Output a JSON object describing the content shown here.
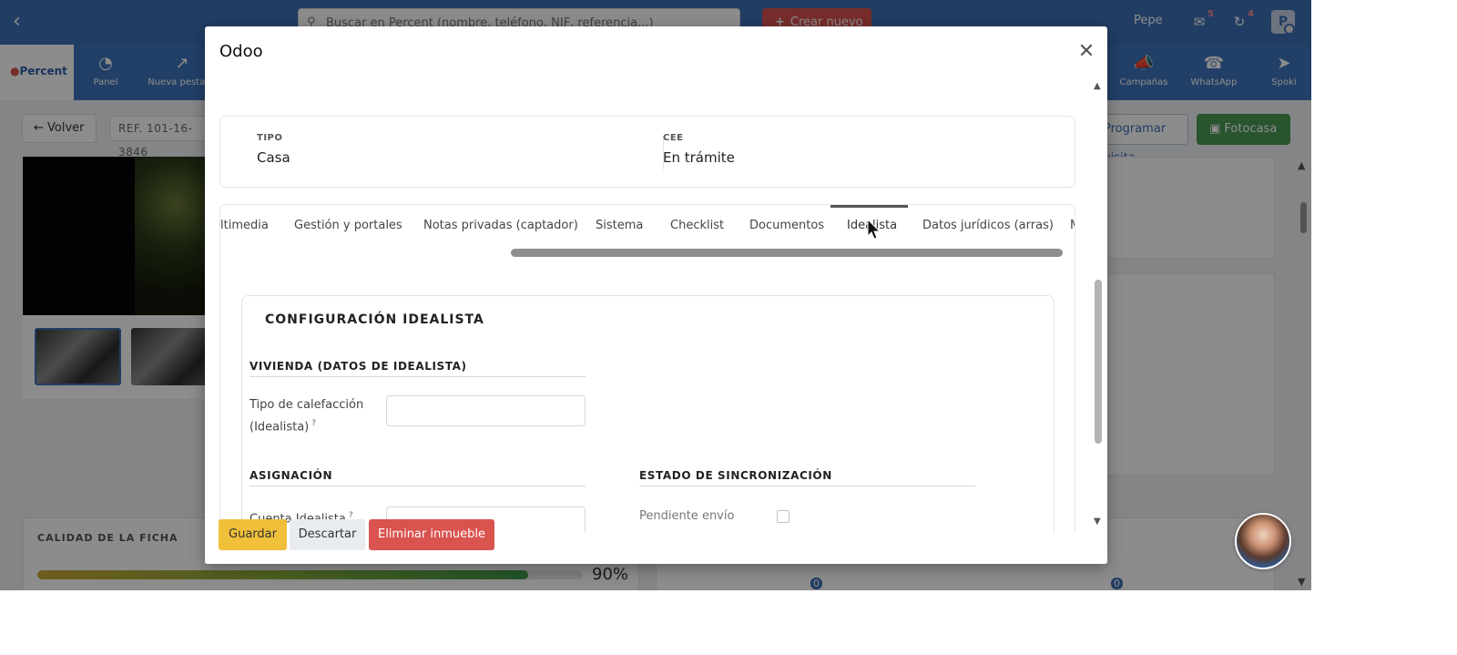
{
  "topbar": {
    "search_placeholder": "Buscar en Percent (nombre, teléfono, NIF, referencia...)",
    "create_label": "Crear nuevo",
    "user_name": "Pepe",
    "messages_badge": "5",
    "history_badge": "4",
    "avatar_initial": "P"
  },
  "nav": {
    "logo_brand": "Percent",
    "items": [
      {
        "label": "Panel",
        "icon": "dashboard-icon"
      },
      {
        "label": "Nueva pestaña",
        "icon": "external-link-icon"
      },
      {
        "label": "Campañas",
        "icon": "megaphone-icon"
      },
      {
        "label": "WhatsApp",
        "icon": "whatsapp-icon"
      },
      {
        "label": "Spoki",
        "icon": "paper-plane-icon"
      }
    ]
  },
  "page": {
    "back_label": "Volver",
    "reference": "REF. 101-16-3846",
    "schedule_visit_label": "Programar visita",
    "fotocasa_label": "Fotocasa",
    "quality_title": "CALIDAD DE LA FICHA",
    "quality_percent": 90,
    "quality_percent_label": "90%",
    "stat_a": "0",
    "stat_b": "0"
  },
  "modal": {
    "title": "Odoo",
    "tipo_label": "TIPO",
    "tipo_value": "Casa",
    "cee_label": "CEE",
    "cee_value": "En trámite",
    "tabs": [
      {
        "label": "Multimedia",
        "visible_text": "ltimedia"
      },
      {
        "label": "Gestión y portales"
      },
      {
        "label": "Notas privadas (captador)"
      },
      {
        "label": "Sistema"
      },
      {
        "label": "Checklist"
      },
      {
        "label": "Documentos"
      },
      {
        "label": "Idealista"
      },
      {
        "label": "Datos jurídicos (arras)"
      },
      {
        "label": "M"
      }
    ],
    "active_tab": "Idealista",
    "config_title": "CONFIGURACIÓN IDEALISTA",
    "section_vivienda": "VIVIENDA (DATOS DE IDEALISTA)",
    "field_calefaccion_label": "Tipo de calefacción (Idealista)",
    "section_asignacion": "ASIGNACIÓN",
    "field_cuenta_label": "Cuenta Idealista",
    "section_sync": "ESTADO DE SINCRONIZACIÓN",
    "field_pendiente_label": "Pendiente envío",
    "help_mark": "?",
    "save_label": "Guardar",
    "discard_label": "Descartar",
    "delete_label": "Eliminar inmueble"
  }
}
